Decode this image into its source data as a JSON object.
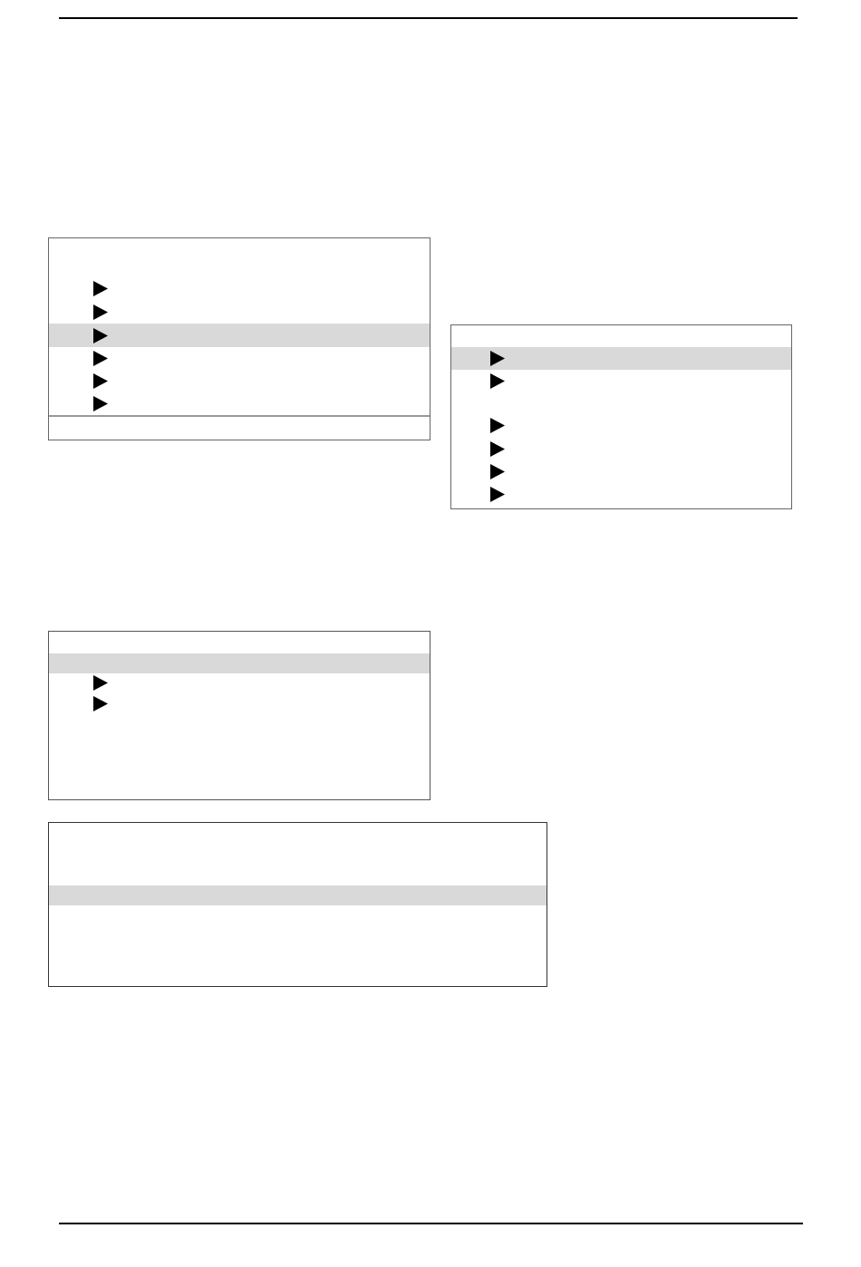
{
  "menus": [
    {
      "footer": true,
      "rows": [
        {
          "pointer": false,
          "selected": false
        },
        {
          "pointer": true,
          "selected": false
        },
        {
          "pointer": true,
          "selected": false
        },
        {
          "pointer": true,
          "selected": true
        },
        {
          "pointer": true,
          "selected": false
        },
        {
          "pointer": true,
          "selected": false
        },
        {
          "pointer": true,
          "selected": false
        }
      ]
    },
    {
      "footer": false,
      "rows": [
        {
          "pointer": false,
          "selected": false
        },
        {
          "pointer": true,
          "selected": true
        },
        {
          "pointer": true,
          "selected": false
        },
        {
          "pointer": false,
          "selected": false
        },
        {
          "pointer": true,
          "selected": false
        },
        {
          "pointer": true,
          "selected": false
        },
        {
          "pointer": true,
          "selected": false
        },
        {
          "pointer": true,
          "selected": false
        }
      ]
    },
    {
      "footer": false,
      "rows": [
        {
          "pointer": false,
          "selected": false
        },
        {
          "pointer": false,
          "selected": true
        },
        {
          "pointer": true,
          "selected": false
        },
        {
          "pointer": true,
          "selected": false
        },
        {
          "pointer": false,
          "selected": false
        },
        {
          "pointer": false,
          "selected": false
        },
        {
          "pointer": false,
          "selected": false
        },
        {
          "pointer": false,
          "selected": false
        }
      ]
    },
    {
      "footer": false,
      "rows": [
        {
          "pointer": false,
          "selected": false
        },
        {
          "pointer": false,
          "selected": false
        },
        {
          "pointer": false,
          "selected": false
        },
        {
          "pointer": false,
          "selected": true
        },
        {
          "pointer": false,
          "selected": false
        },
        {
          "pointer": false,
          "selected": false
        },
        {
          "pointer": false,
          "selected": false
        },
        {
          "pointer": false,
          "selected": false
        }
      ]
    }
  ]
}
